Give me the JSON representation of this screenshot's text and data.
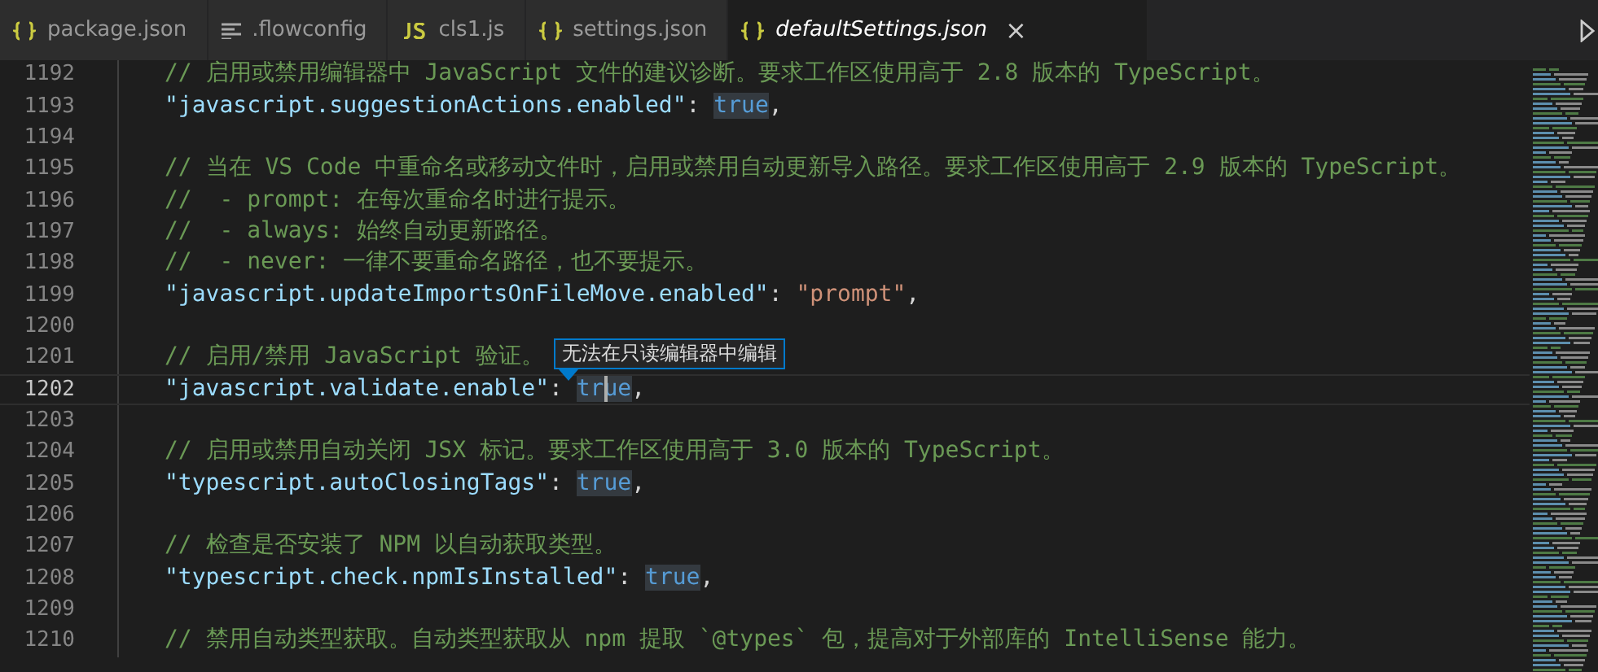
{
  "tabs": [
    {
      "label": "package.json",
      "kind": "json",
      "selected": false
    },
    {
      "label": ".flowconfig",
      "kind": "config",
      "selected": false
    },
    {
      "label": "cls1.js",
      "kind": "script",
      "selected": false
    },
    {
      "label": "settings.json",
      "kind": "json",
      "selected": false
    },
    {
      "label": "defaultSettings.json",
      "kind": "json",
      "selected": true,
      "close": "×"
    }
  ],
  "editor": {
    "tooltip": "无法在只读编辑器中编辑",
    "lines": [
      {
        "number": "1192",
        "current": false,
        "tokens": [
          {
            "kind": "comment",
            "text": "// 启用或禁用编辑器中 JavaScript 文件的建议诊断。要求工作区使用高于 2.8 版本的 TypeScript。"
          }
        ]
      },
      {
        "number": "1193",
        "current": false,
        "tokens": [
          {
            "kind": "key",
            "text": "\"javascript.suggestionActions.enabled\""
          },
          {
            "kind": "punct",
            "text": ": "
          },
          {
            "kind": "keyword",
            "text": "true",
            "highlighted": true
          },
          {
            "kind": "punct",
            "text": ","
          }
        ]
      },
      {
        "number": "1194",
        "current": false
      },
      {
        "number": "1195",
        "current": false,
        "tokens": [
          {
            "kind": "comment",
            "text": "// 当在 VS Code 中重命名或移动文件时，启用或禁用自动更新导入路径。要求工作区使用高于 2.9 版本的 TypeScript。"
          }
        ]
      },
      {
        "number": "1196",
        "current": false,
        "tokens": [
          {
            "kind": "comment",
            "text": "//  - prompt: 在每次重命名时进行提示。"
          }
        ]
      },
      {
        "number": "1197",
        "current": false,
        "tokens": [
          {
            "kind": "comment",
            "text": "//  - always: 始终自动更新路径。"
          }
        ]
      },
      {
        "number": "1198",
        "current": false,
        "tokens": [
          {
            "kind": "comment",
            "text": "//  - never: 一律不要重命名路径，也不要提示。"
          }
        ]
      },
      {
        "number": "1199",
        "current": false,
        "tokens": [
          {
            "kind": "key",
            "text": "\"javascript.updateImportsOnFileMove.enabled\""
          },
          {
            "kind": "punct",
            "text": ": "
          },
          {
            "kind": "string",
            "text": "\"prompt\""
          },
          {
            "kind": "punct",
            "text": ","
          }
        ]
      },
      {
        "number": "1200",
        "current": false
      },
      {
        "number": "1201",
        "current": false,
        "tokens": [
          {
            "kind": "comment",
            "text": "// 启用/禁用 JavaScript 验证。"
          }
        ]
      },
      {
        "number": "1202",
        "current": true,
        "tokens": [
          {
            "kind": "key",
            "text": "\"javascript.validate.enable\""
          },
          {
            "kind": "punct",
            "text": ": "
          },
          {
            "kind": "keyword",
            "text": "true",
            "highlighted": true
          },
          {
            "kind": "punct",
            "text": ","
          }
        ]
      },
      {
        "number": "1203",
        "current": false
      },
      {
        "number": "1204",
        "current": false,
        "tokens": [
          {
            "kind": "comment",
            "text": "// 启用或禁用自动关闭 JSX 标记。要求工作区使用高于 3.0 版本的 TypeScript。"
          }
        ]
      },
      {
        "number": "1205",
        "current": false,
        "tokens": [
          {
            "kind": "key",
            "text": "\"typescript.autoClosingTags\""
          },
          {
            "kind": "punct",
            "text": ": "
          },
          {
            "kind": "keyword",
            "text": "true",
            "highlighted": true
          },
          {
            "kind": "punct",
            "text": ","
          }
        ]
      },
      {
        "number": "1206",
        "current": false
      },
      {
        "number": "1207",
        "current": false,
        "tokens": [
          {
            "kind": "comment",
            "text": "// 检查是否安装了 NPM 以自动获取类型。"
          }
        ]
      },
      {
        "number": "1208",
        "current": false,
        "tokens": [
          {
            "kind": "key",
            "text": "\"typescript.check.npmIsInstalled\""
          },
          {
            "kind": "punct",
            "text": ": "
          },
          {
            "kind": "keyword",
            "text": "true",
            "highlighted": true
          },
          {
            "kind": "punct",
            "text": ","
          }
        ]
      },
      {
        "number": "1209",
        "current": false
      },
      {
        "number": "1210",
        "current": false,
        "tokens": [
          {
            "kind": "comment",
            "text": "// 禁用自动类型获取。自动类型获取从 npm 提取 `@types` 包，提高对于外部库的 IntelliSense 能力。"
          }
        ]
      }
    ]
  }
}
